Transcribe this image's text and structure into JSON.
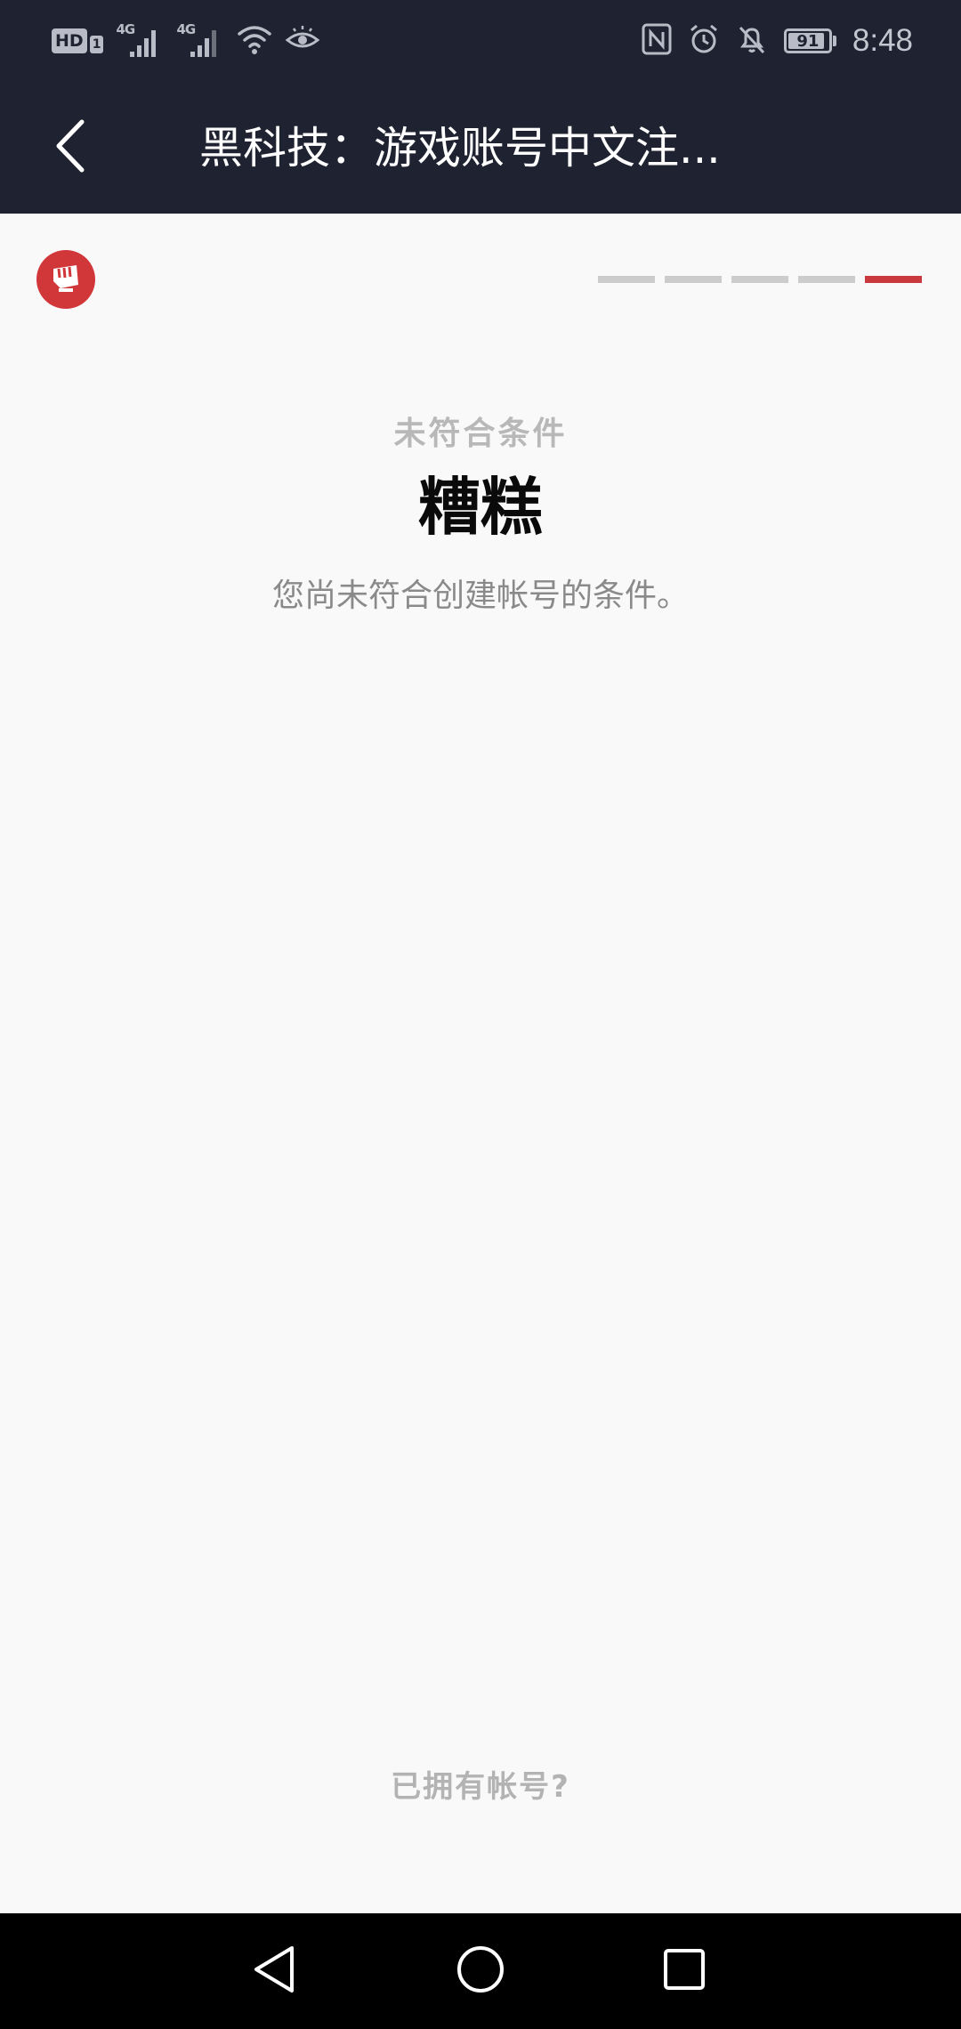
{
  "status_bar": {
    "hd_label": "HD",
    "sim_label": "1",
    "network_1": "4G",
    "network_2": "4G",
    "battery_level": "91",
    "time": "8:48"
  },
  "header": {
    "title": "黑科技：游戏账号中文注..."
  },
  "progress": {
    "total_steps": 5,
    "current_step": 5
  },
  "content": {
    "eyebrow": "未符合条件",
    "heading": "糟糕",
    "message": "您尚未符合创建帐号的条件。",
    "signin_link": "已拥有帐号?"
  },
  "colors": {
    "header_bg": "#1f2230",
    "accent": "#c9393d",
    "logo_bg": "#d13639",
    "page_bg": "#f9f9f9"
  },
  "icons": {
    "back": "chevron-left-icon",
    "logo": "riot-fist-icon"
  }
}
